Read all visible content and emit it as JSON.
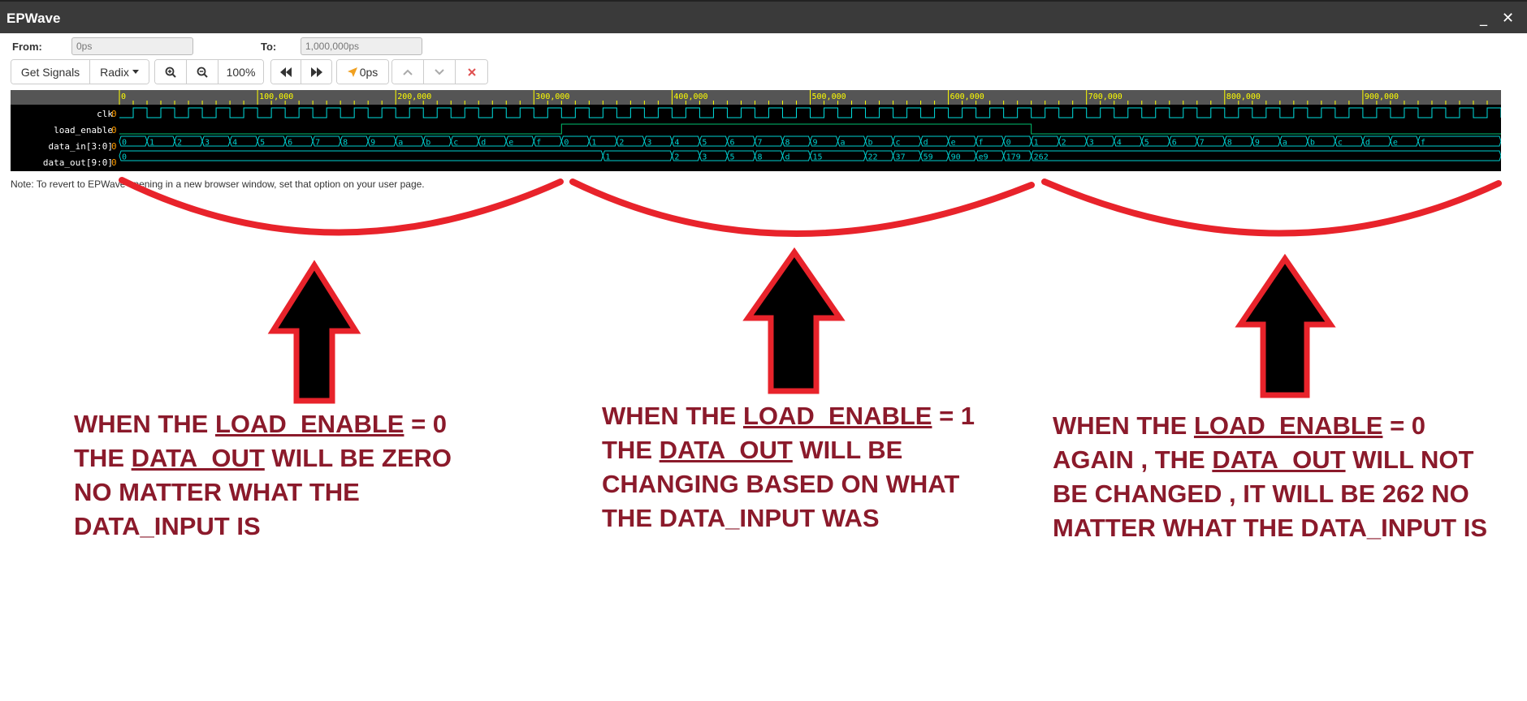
{
  "window": {
    "title": "EPWave",
    "minimize_glyph": "_",
    "close_glyph": "✕"
  },
  "range": {
    "from_label": "From:",
    "from_value": "0ps",
    "to_label": "To:",
    "to_value": "1,000,000ps"
  },
  "toolbar": {
    "get_signals": "Get Signals",
    "radix": "Radix",
    "zoom_level": "100%",
    "cursor_time": "0ps"
  },
  "waveform": {
    "ruler_labels": [
      "0",
      "100,000",
      "200,000",
      "300,000",
      "400,000",
      "500,000",
      "600,000",
      "700,000",
      "800,000",
      "900,000"
    ],
    "signals": [
      {
        "name": "clk",
        "value": "0"
      },
      {
        "name": "load_enable",
        "value": "0"
      },
      {
        "name": "data_in[3:0]",
        "value": "0"
      },
      {
        "name": "data_out[9:0]",
        "value": "0"
      }
    ],
    "data_in_values": [
      "0",
      "1",
      "2",
      "3",
      "4",
      "5",
      "6",
      "7",
      "8",
      "9",
      "a",
      "b",
      "c",
      "d",
      "e",
      "f",
      "0",
      "1",
      "2",
      "3",
      "4",
      "5",
      "6",
      "7",
      "8",
      "9",
      "a",
      "b",
      "c",
      "d",
      "e",
      "f",
      "0",
      "1",
      "2",
      "3",
      "4",
      "5",
      "6",
      "7",
      "8",
      "9",
      "a",
      "b",
      "c",
      "d",
      "e",
      "f"
    ],
    "data_out_values": [
      "0",
      "1",
      "2",
      "3",
      "5",
      "8",
      "d",
      "15",
      "22",
      "37",
      "59",
      "90",
      "e9",
      "179",
      "262"
    ],
    "load_enable_high_start": 320000,
    "load_enable_high_end": 660000,
    "colors": {
      "clk": "#00e0e0",
      "load_enable": "#00c070",
      "bus": "#00d0d0",
      "ruler_text": "#ffff00",
      "value_text": "#ff9d00"
    }
  },
  "note": "Note: To revert to EPWave opening in a new browser window, set that option on your user page.",
  "annotations": [
    {
      "lines": [
        [
          {
            "t": "WHEN THE ",
            "u": false
          },
          {
            "t": "LOAD_ENABLE",
            "u": true
          },
          {
            "t": " = 0",
            "u": false
          }
        ],
        [
          {
            "t": "THE ",
            "u": false
          },
          {
            "t": "DATA_OUT",
            "u": true
          },
          {
            "t": " WILL BE ZERO",
            "u": false
          }
        ],
        [
          {
            "t": "NO MATTER WHAT THE",
            "u": false
          }
        ],
        [
          {
            "t": "DATA_INPUT IS",
            "u": false
          }
        ]
      ]
    },
    {
      "lines": [
        [
          {
            "t": "WHEN THE ",
            "u": false
          },
          {
            "t": "LOAD_ENABLE",
            "u": true
          },
          {
            "t": " = 1",
            "u": false
          }
        ],
        [
          {
            "t": "THE ",
            "u": false
          },
          {
            "t": "DATA_OUT",
            "u": true
          },
          {
            "t": " WILL BE",
            "u": false
          }
        ],
        [
          {
            "t": "CHANGING  BASED ON WHAT",
            "u": false
          }
        ],
        [
          {
            "t": "THE DATA_INPUT WAS",
            "u": false
          }
        ]
      ]
    },
    {
      "lines": [
        [
          {
            "t": "WHEN THE ",
            "u": false
          },
          {
            "t": "LOAD_ENABLE",
            "u": true
          },
          {
            "t": " = 0",
            "u": false
          }
        ],
        [
          {
            "t": "AGAIN , THE ",
            "u": false
          },
          {
            "t": "DATA_OUT",
            "u": true
          },
          {
            "t": " WILL NOT",
            "u": false
          }
        ],
        [
          {
            "t": "BE  CHANGED , IT WILL BE 262 NO",
            "u": false
          }
        ],
        [
          {
            "t": "MATTER WHAT THE DATA_INPUT IS",
            "u": false
          }
        ]
      ]
    }
  ]
}
